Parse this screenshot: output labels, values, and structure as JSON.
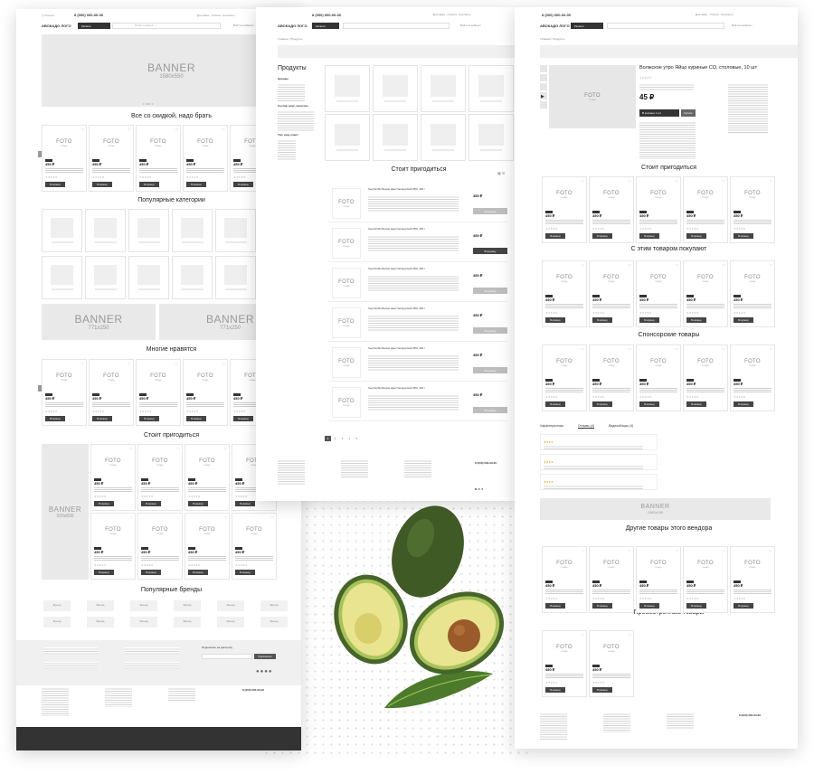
{
  "header": {
    "phone": "8 (000) 000-00-00",
    "logo": "АВОКАДО ЛОГО",
    "catalog_button": "Каталог",
    "search_placeholder": "Поиск товаров",
    "login": "Войти в кабинет"
  },
  "home": {
    "banner_main": {
      "title": "BANNER",
      "size": "1580х550"
    },
    "section_discount": "Все со скидкой, надо брать",
    "section_popular_categories": "Популярные категории",
    "banner_half": {
      "title": "BANNER",
      "size": "771х250"
    },
    "section_liked": "Многие нравятся",
    "section_useful": "Стоит пригодиться",
    "banner_side": {
      "title": "BANNER",
      "size": "320х830"
    },
    "section_brands": "Популярные бренды",
    "brand_label": "Бренд",
    "newsletter_title": "Подпишись на рассылку",
    "newsletter_button": "Подписаться"
  },
  "catalog": {
    "breadcrumb": "Главная / Продукты",
    "title": "Продукты",
    "filters": [
      "Бренды",
      "Состав, вкус, качество",
      "Тип, вид, класс"
    ],
    "useful_title": "Стоит пригодиться",
    "list_item_title": "Сыр Dorblu Белаш Цеис белорусский 45%, 200 г",
    "list_item_price": "450 ₽",
    "add_button": "В корзину",
    "pagination": [
      "1",
      "2",
      "3",
      "4",
      "5"
    ]
  },
  "product": {
    "breadcrumb": "Главная / Продукты",
    "title": "Волжское утро Яйцо куриные СО, столовые, 10 шт",
    "price": "45 ₽",
    "cart_button": "В корзине 1 шт",
    "buy_button": "Купить",
    "related_title": "Стоит пригодиться",
    "together_title": "С этим товаром покупают",
    "sponsored_title": "Спонсорские товары",
    "tabs": [
      "Характеристики",
      "Отзывы (4)",
      "Видеообзоры (4)"
    ],
    "banner": {
      "title": "BANNER",
      "size": "1580х150"
    },
    "vendor_title": "Другие товары этого вендора",
    "viewed_title": "Просмотренные товары"
  },
  "card": {
    "foto": "FOTO",
    "placeholder": "image",
    "price": "450 ₽",
    "button": "В корзину"
  },
  "colors": {
    "placeholder": "#ededed",
    "button": "#444444",
    "footer": "#333333",
    "avocado_skin": "#3f5a25",
    "avocado_flesh": "#e9e48f",
    "avocado_pit": "#9a5a2a"
  }
}
